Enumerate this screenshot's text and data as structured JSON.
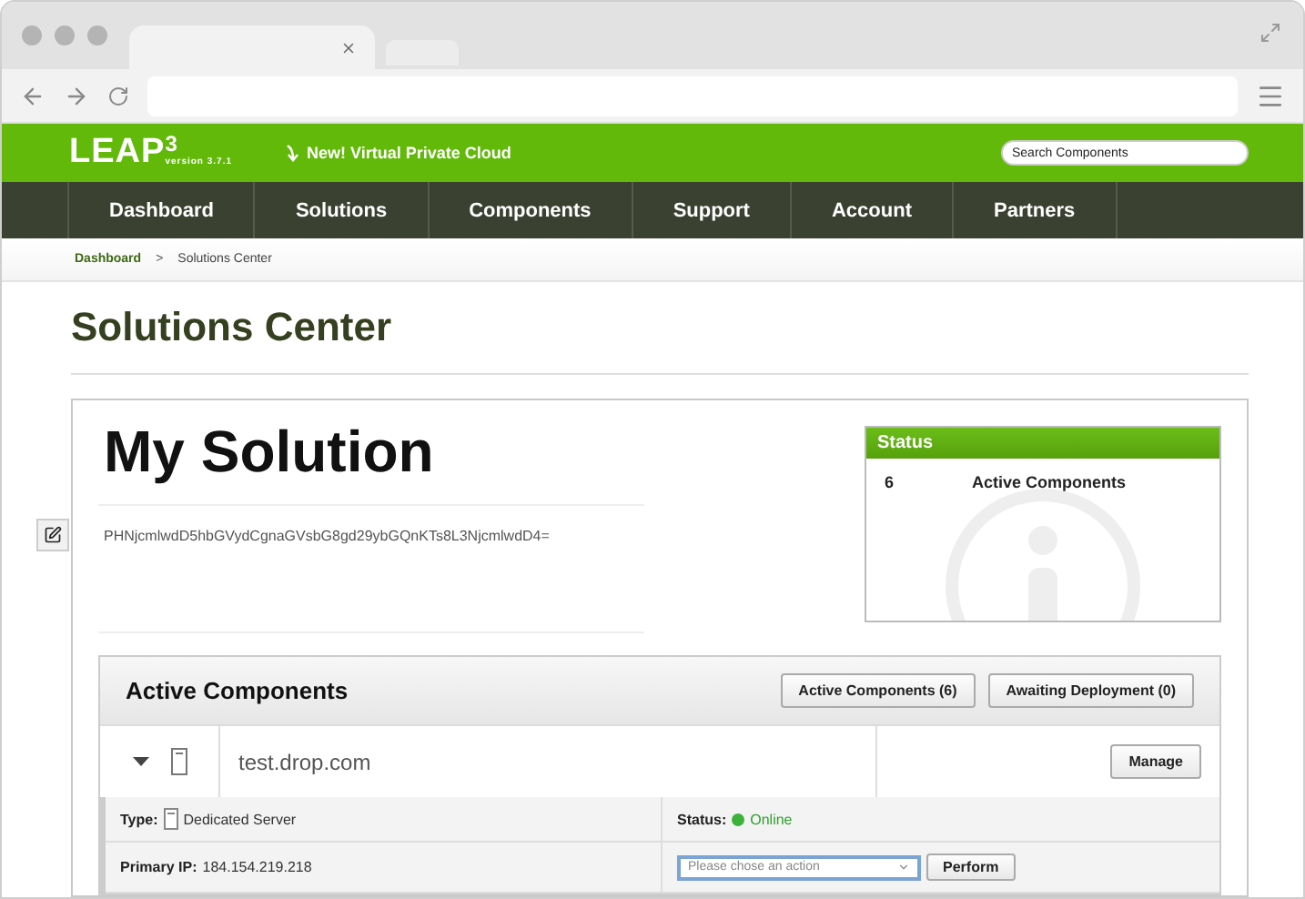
{
  "header": {
    "logo": "LEAP",
    "logo_sup": "3",
    "version": "version 3.7.1",
    "announcement": "New! Virtual Private Cloud",
    "search": {
      "placeholder": "Search Components"
    }
  },
  "nav": [
    {
      "label": "Dashboard"
    },
    {
      "label": "Solutions"
    },
    {
      "label": "Components"
    },
    {
      "label": "Support"
    },
    {
      "label": "Account"
    },
    {
      "label": "Partners"
    }
  ],
  "breadcrumb": {
    "items": [
      {
        "label": "Dashboard",
        "link": true
      },
      {
        "label": "Solutions Center",
        "link": false
      }
    ],
    "separator": ">"
  },
  "page_title": "Solutions Center",
  "solution": {
    "title": "My Solution",
    "code": "PHNjcmlwdD5hbGVydCgnaGVsbG8gd29ybGQnKTs8L3NjcmlwdD4="
  },
  "status_panel": {
    "title": "Status",
    "rows": [
      {
        "count": "6",
        "label": "Active Components"
      }
    ]
  },
  "components": {
    "title": "Active Components",
    "filters": [
      {
        "label": "Active Components (6)"
      },
      {
        "label": "Awaiting Deployment (0)"
      }
    ],
    "rows": [
      {
        "name": "test.drop.com",
        "expanded": true,
        "action": "Manage",
        "details": {
          "type_label": "Type:",
          "type": "Dedicated Server",
          "status_label": "Status:",
          "status": "Online",
          "online": true,
          "ip_label": "Primary IP:",
          "ip": "184.154.219.218",
          "select": {
            "placeholder": "Please chose an action"
          },
          "perform": "Perform"
        }
      }
    ]
  }
}
